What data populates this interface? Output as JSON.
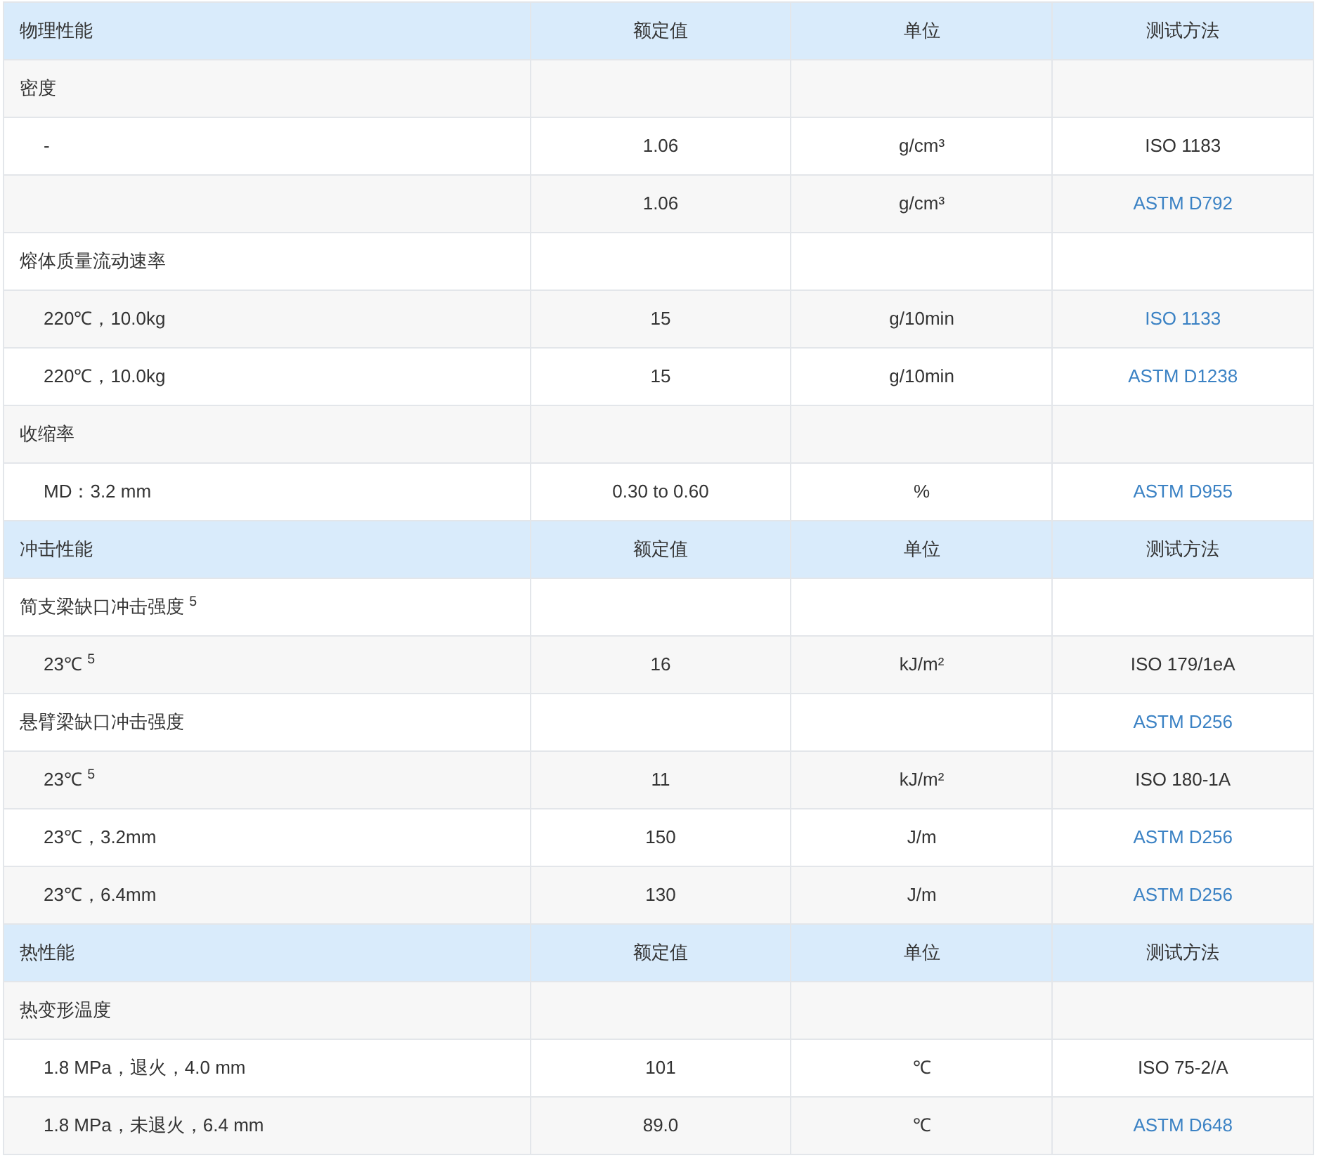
{
  "sections": [
    {
      "header": [
        "物理性能",
        "额定值",
        "单位",
        "测试方法"
      ],
      "rows": [
        {
          "property": "密度"
        },
        {
          "property": "-",
          "value": "1.06",
          "unit": "g/cm³",
          "method": "ISO 1183",
          "method_link": false
        },
        {
          "value": "1.06",
          "unit": "g/cm³",
          "method": "ASTM D792",
          "method_link": true
        },
        {
          "property": "熔体质量流动速率"
        },
        {
          "property": "220℃，10.0kg",
          "value": "15",
          "unit": "g/10min",
          "method": "ISO 1133",
          "method_link": true
        },
        {
          "property": "220℃，10.0kg",
          "value": "15",
          "unit": "g/10min",
          "method": "ASTM D1238",
          "method_link": true
        },
        {
          "property": "收缩率"
        },
        {
          "property": "MD：3.2 mm",
          "value": "0.30 to 0.60",
          "unit": "%",
          "method": "ASTM D955",
          "method_link": true
        }
      ]
    },
    {
      "header": [
        "冲击性能",
        "额定值",
        "单位",
        "测试方法"
      ],
      "rows": [
        {
          "property": "简支梁缺口冲击强度 $^{5}$"
        },
        {
          "property": "23℃ $^{5}$",
          "value": "16",
          "unit": "kJ/m²",
          "method": "ISO 179/1eA",
          "method_link": false
        },
        {
          "property": "悬臂梁缺口冲击强度",
          "method": "ASTM D256",
          "method_link": true
        },
        {
          "property": "23℃ $^{5}$",
          "value": "11",
          "unit": "kJ/m²",
          "method": "ISO 180-1A",
          "method_link": false
        },
        {
          "property": "23℃，3.2mm",
          "value": "150",
          "unit": "J/m",
          "method": "ASTM D256",
          "method_link": true
        },
        {
          "property": "23℃，6.4mm",
          "value": "130",
          "unit": "J/m",
          "method": "ASTM D256",
          "method_link": true
        }
      ]
    },
    {
      "header": [
        "热性能",
        "额定值",
        "单位",
        "测试方法"
      ],
      "rows": [
        {
          "property": "热变形温度"
        },
        {
          "property": "1.8 MPa，退火，4.0 mm",
          "value": "101",
          "unit": "℃",
          "method": "ISO 75-2/A",
          "method_link": false
        },
        {
          "property": "1.8 MPa，未退火，6.4 mm",
          "value": "89.0",
          "unit": "℃",
          "method": "ASTM D648",
          "method_link": true
        }
      ]
    }
  ]
}
